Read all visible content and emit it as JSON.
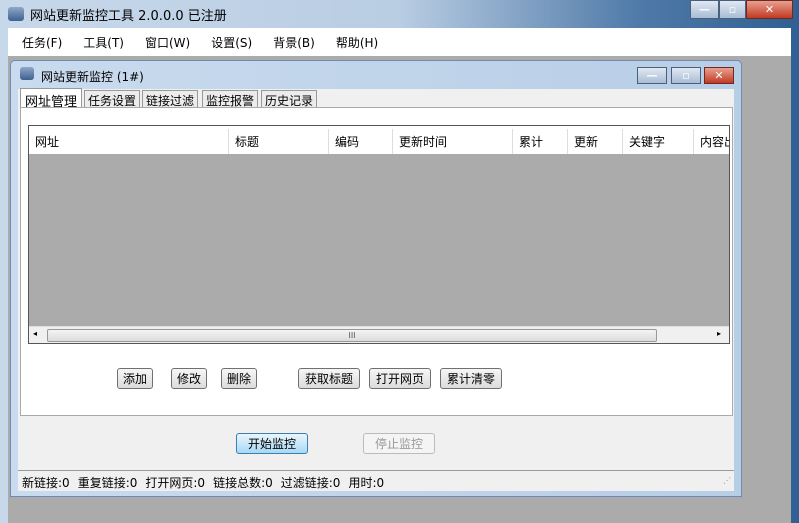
{
  "app": {
    "title": "网站更新监控工具 2.0.0.0  已注册"
  },
  "menu": [
    "任务(F)",
    "工具(T)",
    "窗口(W)",
    "设置(S)",
    "背景(B)",
    "帮助(H)"
  ],
  "child": {
    "title": "网站更新监控  (1#)"
  },
  "tabs": [
    "网址管理",
    "任务设置",
    "链接过滤",
    "监控报警",
    "历史记录"
  ],
  "columns": [
    "网址",
    "标题",
    "编码",
    "更新时间",
    "累计",
    "更新",
    "关键字",
    "内容出"
  ],
  "buttons": {
    "add": "添加",
    "edit": "修改",
    "delete": "删除",
    "get_title": "获取标题",
    "open_page": "打开网页",
    "reset_count": "累计清零",
    "start": "开始监控",
    "stop": "停止监控"
  },
  "scroll_grip": "III",
  "status": [
    "新链接:0",
    "重复链接:0",
    "打开网页:0",
    "链接总数:0",
    "过滤链接:0",
    "用时:0"
  ]
}
